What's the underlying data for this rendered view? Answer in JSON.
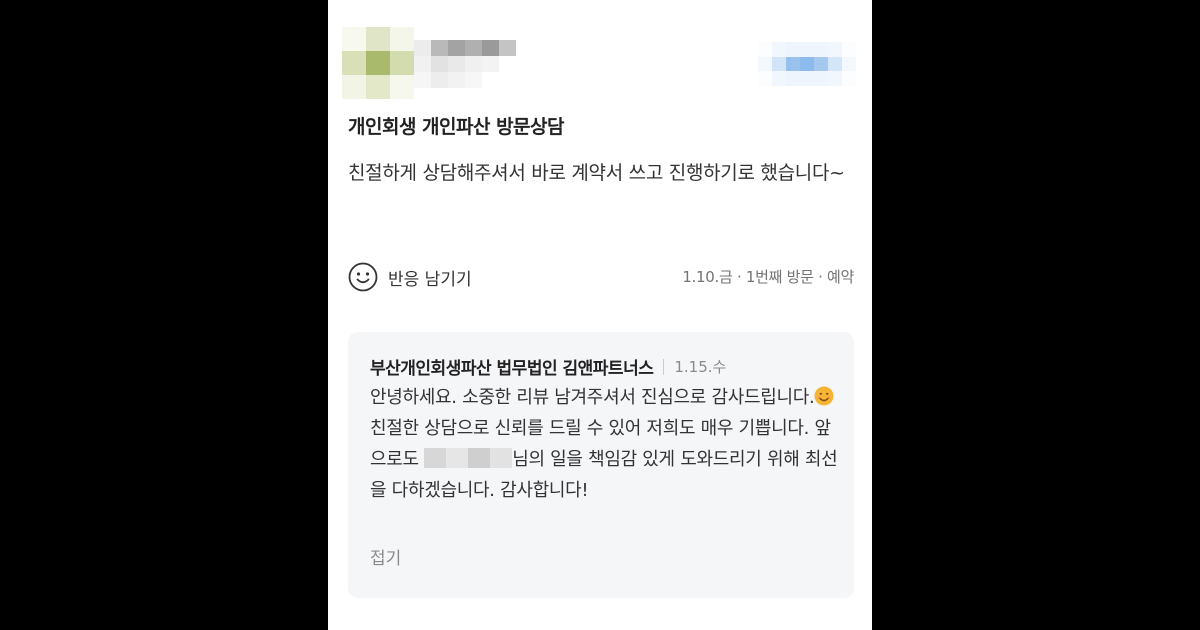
{
  "review": {
    "title": "개인회생 개인파산 방문상담",
    "text": "친절하게 상담해주셔서 바로 계약서 쓰고 진행하기로 했습니다~",
    "react_label": "반응 남기기",
    "meta": "1.10.금 · 1번째 방문 · 예약",
    "icons": {
      "react": "smile-icon"
    }
  },
  "reply": {
    "owner": "부산개인회생파산 법무법인 김앤파트너스",
    "date": "1.15.수",
    "text_part1": "안녕하세요. 소중한 리뷰 남겨주셔서 진심으로 감사드립니다.",
    "text_part2": " 친절한 상담으로 신뢰를 드릴 수 있어 저희도 매우 기쁩니다. 앞으로도 ",
    "text_part3": "님의 일을 책임감 있게 도와드리기 위해 최선을 다하겠습니다. 감사합니다!",
    "fold_label": "접기",
    "icons": {
      "emoji": "smiling-face-icon"
    }
  },
  "colors": {
    "background": "#000000",
    "card": "#ffffff",
    "reply_bg": "#f5f6f8",
    "meta_text": "#737373"
  }
}
